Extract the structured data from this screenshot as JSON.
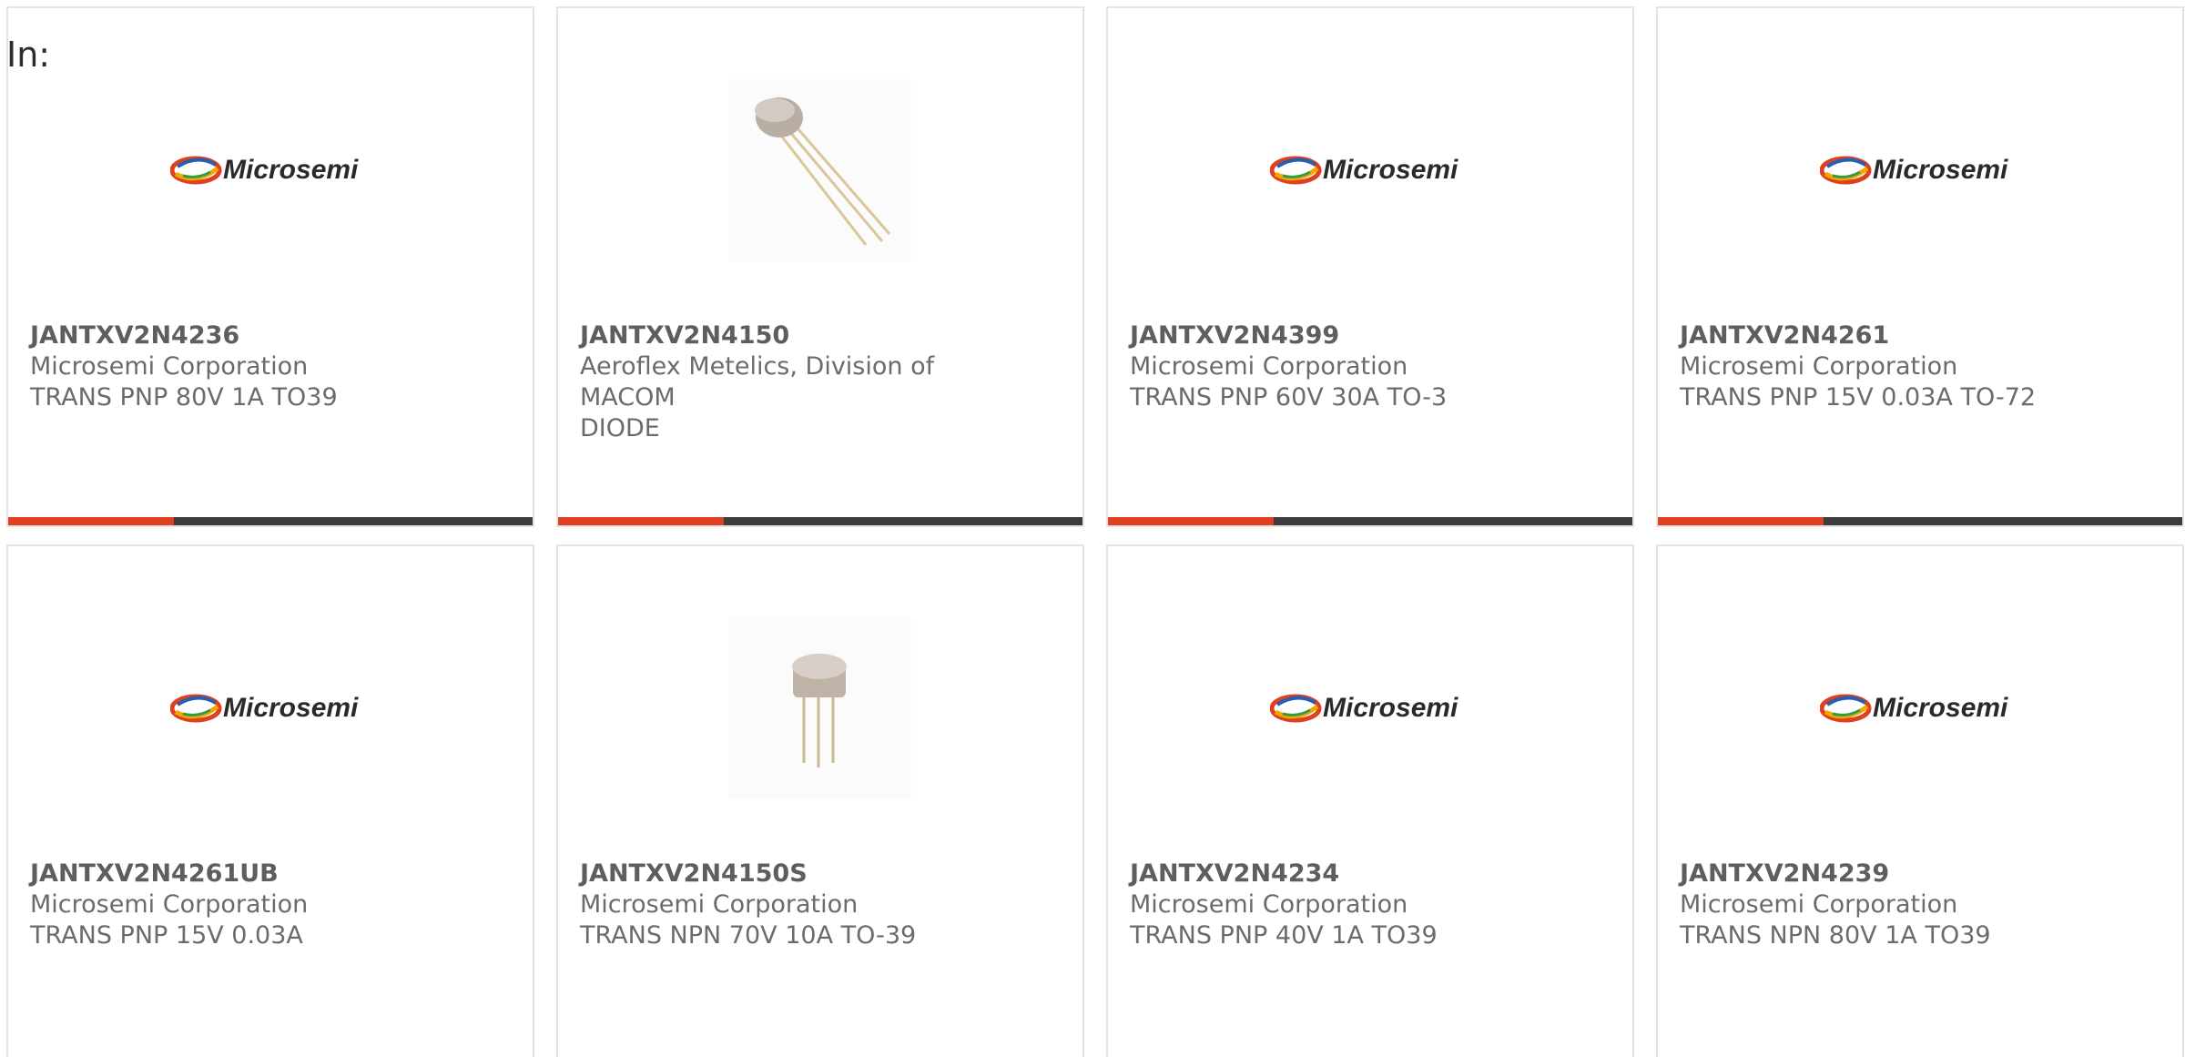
{
  "label": "In:",
  "colors": {
    "accent": "#e0401e",
    "bar": "#3c3c3c",
    "border": "#e3e3e3",
    "text": "#6b6b6b"
  },
  "products": [
    {
      "part": "JANTXV2N4236",
      "maker": "Microsemi Corporation",
      "desc": "TRANS PNP 80V 1A TO39",
      "image": "microsemi-logo"
    },
    {
      "part": "JANTXV2N4150",
      "maker": "Aeroflex Metelics, Division of MACOM",
      "desc": "DIODE",
      "image": "transistor-photo"
    },
    {
      "part": "JANTXV2N4399",
      "maker": "Microsemi Corporation",
      "desc": "TRANS PNP 60V 30A TO-3",
      "image": "microsemi-logo"
    },
    {
      "part": "JANTXV2N4261",
      "maker": "Microsemi Corporation",
      "desc": "TRANS PNP 15V 0.03A TO-72",
      "image": "microsemi-logo"
    },
    {
      "part": "JANTXV2N4261UB",
      "maker": "Microsemi Corporation",
      "desc": "TRANS PNP 15V 0.03A",
      "image": "microsemi-logo"
    },
    {
      "part": "JANTXV2N4150S",
      "maker": "Microsemi Corporation",
      "desc": "TRANS NPN 70V 10A TO-39",
      "image": "transistor-photo"
    },
    {
      "part": "JANTXV2N4234",
      "maker": "Microsemi Corporation",
      "desc": "TRANS PNP 40V 1A TO39",
      "image": "microsemi-logo"
    },
    {
      "part": "JANTXV2N4239",
      "maker": "Microsemi Corporation",
      "desc": "TRANS NPN 80V 1A TO39",
      "image": "microsemi-logo"
    }
  ],
  "logo": {
    "text": "Microsemi"
  }
}
